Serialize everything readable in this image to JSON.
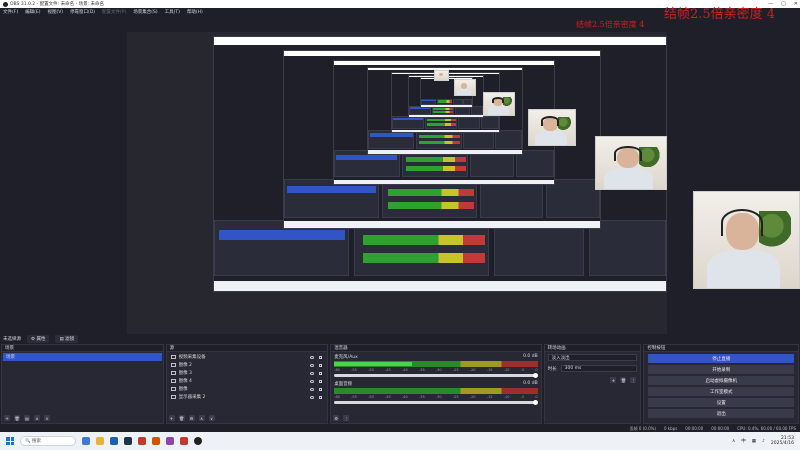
{
  "window": {
    "title": "OBS 31.0.2 - 配置文件: 未命名 - 场景: 未命名"
  },
  "menu": [
    "文件(F)",
    "编辑(E)",
    "视图(V)",
    "停靠窗口(D)",
    "配置文件(P)",
    "场景集合(S)",
    "工具(T)",
    "帮助(H)"
  ],
  "menu_disabled_index": 4,
  "overlay": {
    "big": "结帧2.5倍亲密度 4",
    "small": "结帧2.5倍亲密度 4"
  },
  "scene_bar": {
    "selected_scene": "未选择源",
    "props_label": "属性",
    "filters_label": "滤镜"
  },
  "docks": {
    "scenes": {
      "title": "场景",
      "items": [
        {
          "name": "场景"
        }
      ]
    },
    "sources": {
      "title": "源",
      "items": [
        {
          "name": "视频采集设备"
        },
        {
          "name": "图像 2"
        },
        {
          "name": "图像 3"
        },
        {
          "name": "图像 4"
        },
        {
          "name": "图像"
        },
        {
          "name": "显示器采集 2"
        }
      ]
    },
    "mixer": {
      "title": "混音器",
      "channels": [
        {
          "name": "麦克风/Aux",
          "db": "0.0 dB",
          "level": 0.38
        },
        {
          "name": "桌面音频",
          "db": "0.0 dB",
          "level": 0.0
        }
      ],
      "ticks": [
        "-60",
        "-55",
        "-50",
        "-45",
        "-40",
        "-35",
        "-30",
        "-25",
        "-20",
        "-15",
        "-10",
        "-5",
        "0"
      ]
    },
    "transitions": {
      "title": "转场动画",
      "transition": "淡入淡出",
      "duration_label": "时长",
      "duration_value": "300 ms"
    },
    "controls": {
      "title": "控制按钮",
      "buttons": [
        "停止直播",
        "开始录制",
        "启动虚拟摄像机",
        "工作室模式",
        "设置",
        "退出"
      ]
    }
  },
  "status": {
    "frames": "丢帧 0 (0.0%)",
    "bitrate": "0 kbps",
    "live_time": "00:00:00",
    "rec_time": "00:00:00",
    "cpu": "CPU: 0.4%, 60.00 / 60.00 FPS"
  },
  "taskbar": {
    "search_placeholder": "搜索",
    "time": "21:53",
    "date": "2025/4/16",
    "lang": "中"
  }
}
